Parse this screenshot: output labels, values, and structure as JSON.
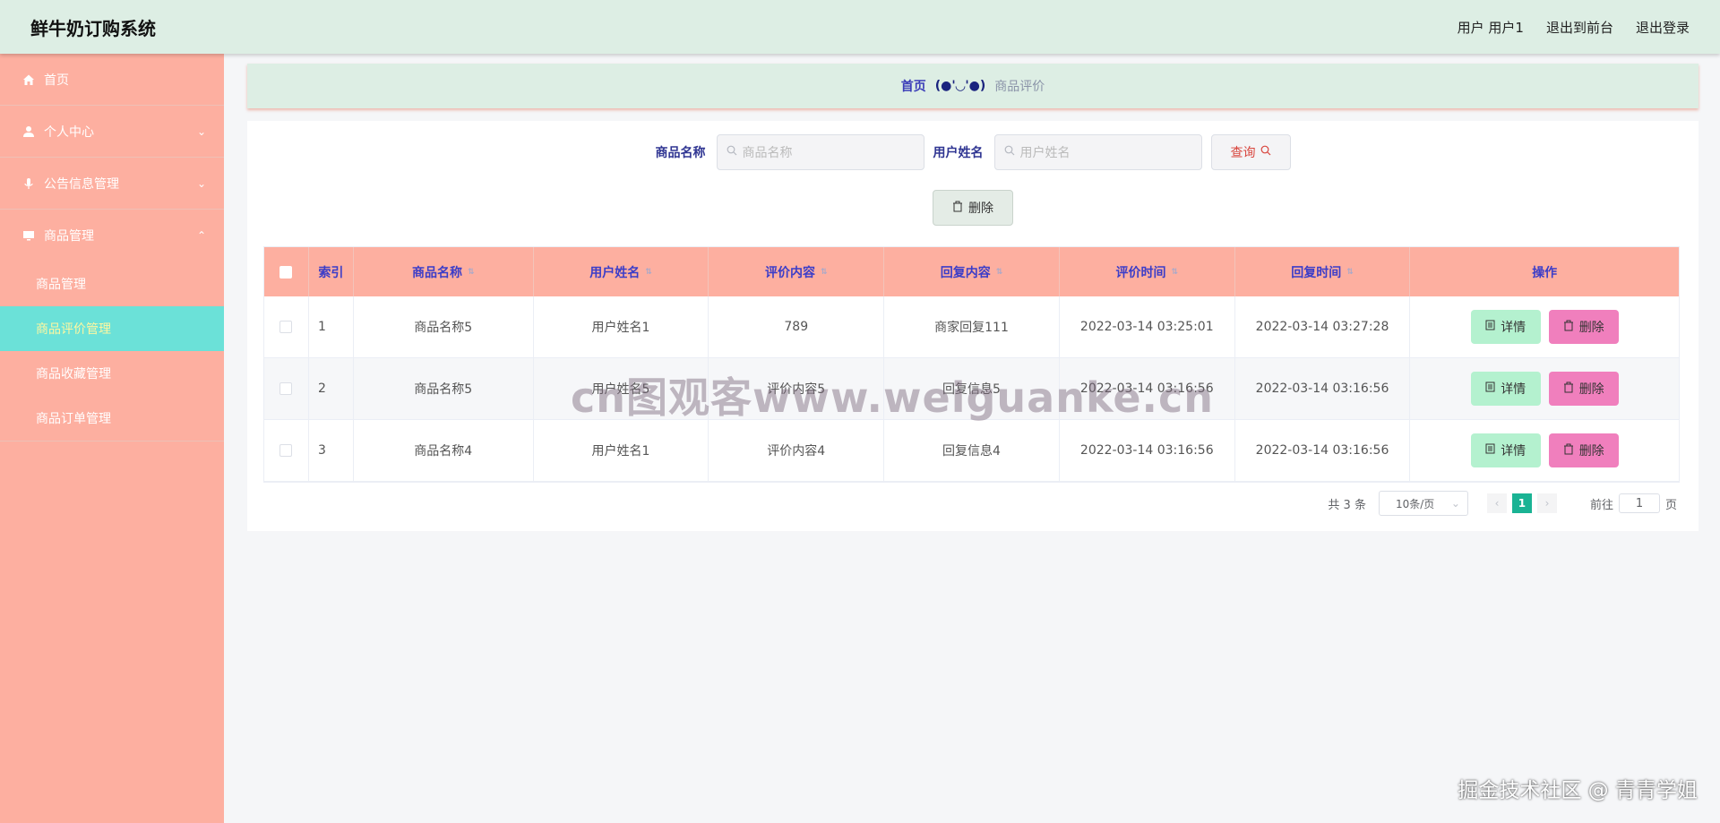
{
  "app": {
    "title": "鲜牛奶订购系统",
    "nav": [
      "用户 用户1",
      "退出到前台",
      "退出登录"
    ]
  },
  "sidebar": {
    "items": [
      {
        "label": "首页",
        "icon": "home-icon"
      },
      {
        "label": "个人中心",
        "icon": "user-icon",
        "arrow": "⌄"
      },
      {
        "label": "公告信息管理",
        "icon": "microphone-icon",
        "arrow": "⌄"
      },
      {
        "label": "商品管理",
        "icon": "monitor-icon",
        "arrow": "⌃"
      }
    ],
    "sub_items": [
      "商品管理",
      "商品评价管理",
      "商品收藏管理",
      "商品订单管理"
    ],
    "active_sub": "商品评价管理"
  },
  "breadcrumb": {
    "home": "首页",
    "sep": "(●'◡'●)",
    "current": "商品评价"
  },
  "search": {
    "product_label": "商品名称",
    "product_placeholder": "商品名称",
    "user_label": "用户姓名",
    "user_placeholder": "用户姓名",
    "query_button": "查询",
    "delete_button": "删除"
  },
  "table": {
    "headers": [
      "索引",
      "商品名称",
      "用户姓名",
      "评价内容",
      "回复内容",
      "评价时间",
      "回复时间",
      "操作"
    ],
    "rows": [
      {
        "index": "1",
        "product": "商品名称5",
        "user": "用户姓名1",
        "review": "789",
        "reply": "商家回复111",
        "review_time": "2022-03-14 03:25:01",
        "reply_time": "2022-03-14 03:27:28"
      },
      {
        "index": "2",
        "product": "商品名称5",
        "user": "用户姓名5",
        "review": "评价内容5",
        "reply": "回复信息5",
        "review_time": "2022-03-14 03:16:56",
        "reply_time": "2022-03-14 03:16:56"
      },
      {
        "index": "3",
        "product": "商品名称4",
        "user": "用户姓名1",
        "review": "评价内容4",
        "reply": "回复信息4",
        "review_time": "2022-03-14 03:16:56",
        "reply_time": "2022-03-14 03:16:56"
      }
    ],
    "detail_label": "详情",
    "delete_label": "删除"
  },
  "pagination": {
    "total": "共 3 条",
    "page_size": "10条/页",
    "current_page": "1",
    "goto_label": "前往",
    "goto_value": "1",
    "page_suffix": "页"
  },
  "watermark": "cn图观客www.weiguanke.cn",
  "credit": "掘金技术社区 @ 青青学姐",
  "colors": {
    "header_bg": "#ddeee4",
    "sidebar_bg": "#fdafa0",
    "active_bg": "#6be1d8",
    "accent_text": "#3b3dc8",
    "detail_btn": "#b4f1cf",
    "delete_btn": "#f07fbd",
    "page_active": "#1ab394"
  }
}
